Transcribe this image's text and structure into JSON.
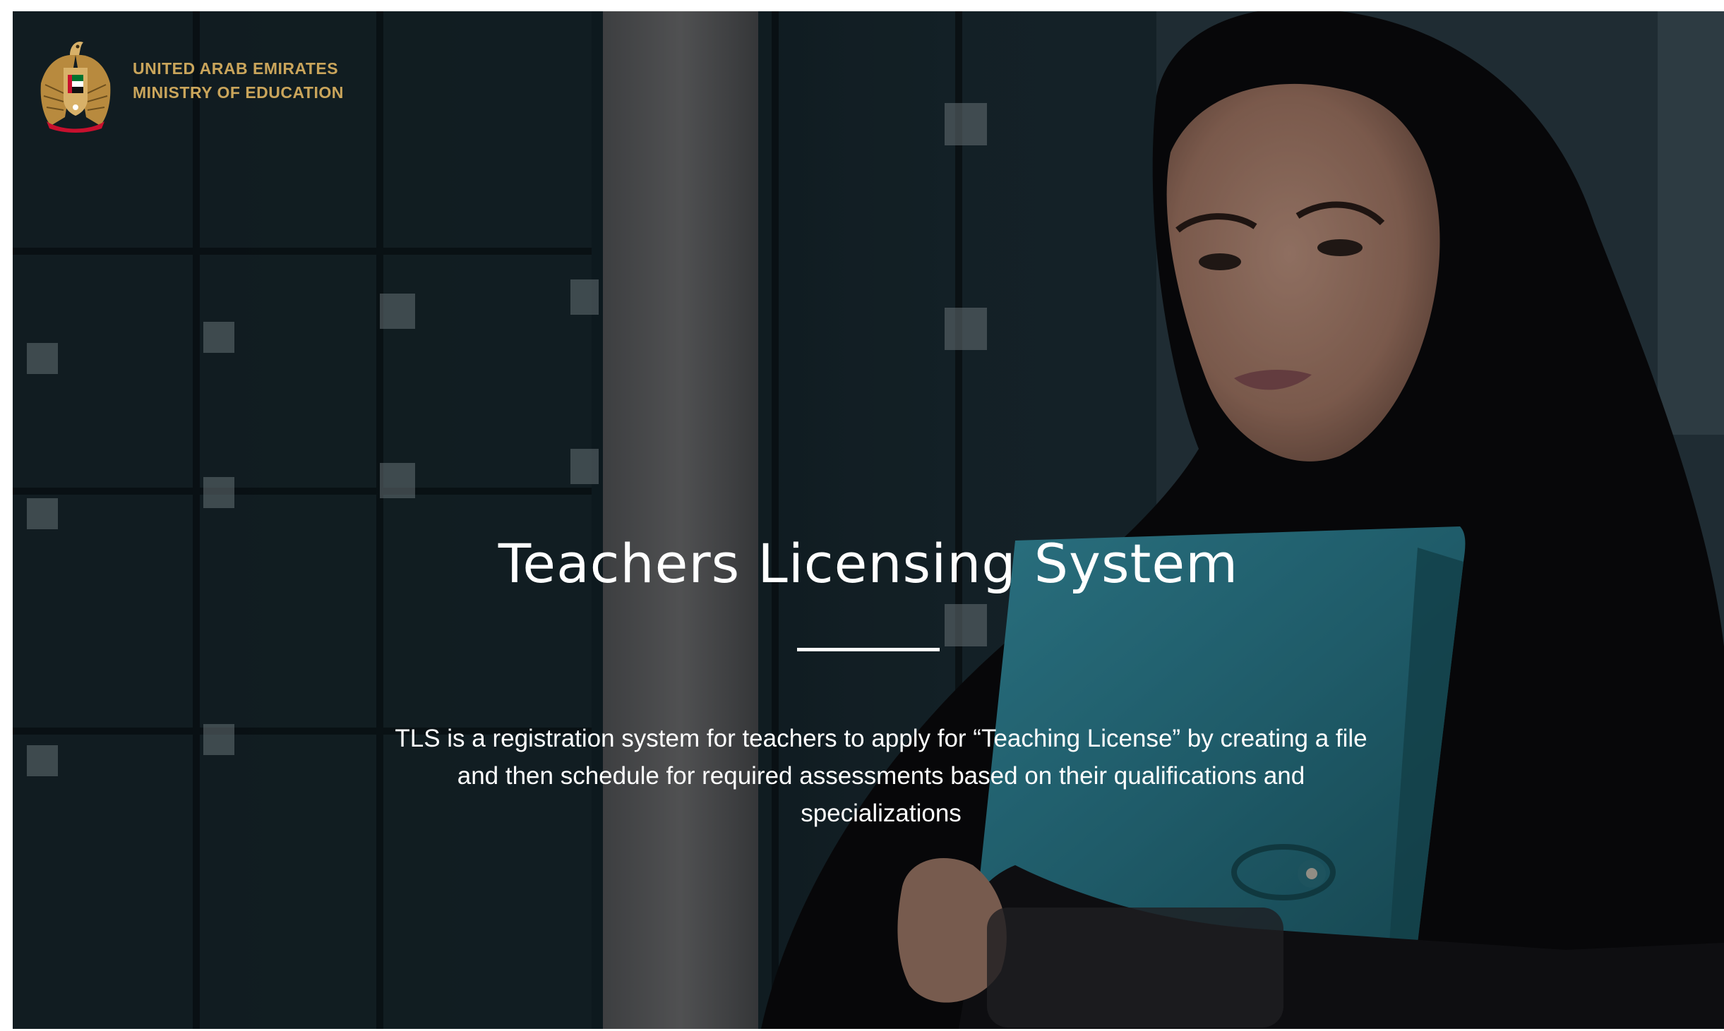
{
  "header": {
    "country": "UNITED ARAB EMIRATES",
    "ministry": "MINISTRY OF EDUCATION",
    "emblem_icon": "uae-falcon-emblem-icon"
  },
  "hero": {
    "title": "Teachers Licensing System",
    "description": "TLS is a registration system for teachers to apply for “Teaching License” by creating a file and then schedule for required assessments based on their qualifications and specializations",
    "background": "photo of a woman in a black hijab holding a teal folder in front of a glass building"
  },
  "colors": {
    "brand_gold": "#caa55b",
    "title_text": "#ffffff",
    "hero_base": "#0d161c",
    "folder": "#2d8a9c"
  }
}
